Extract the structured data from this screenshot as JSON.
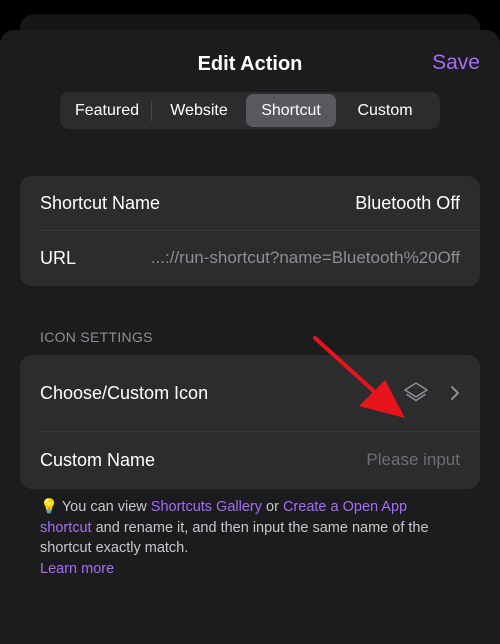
{
  "header": {
    "title": "Edit Action",
    "save_label": "Save"
  },
  "tabs": [
    {
      "label": "Featured",
      "active": false
    },
    {
      "label": "Website",
      "active": false
    },
    {
      "label": "Shortcut",
      "active": true
    },
    {
      "label": "Custom",
      "active": false
    }
  ],
  "shortcut_card": {
    "name_label": "Shortcut Name",
    "name_value": "Bluetooth Off",
    "url_label": "URL",
    "url_value": "...://run-shortcut?name=Bluetooth%20Off"
  },
  "icon_settings": {
    "section_title": "ICON SETTINGS",
    "choose_label": "Choose/Custom Icon",
    "icon": "layers-icon",
    "custom_name_label": "Custom Name",
    "custom_name_placeholder": "Please input"
  },
  "footer": {
    "bulb": "💡",
    "text1": " You can view ",
    "link1": "Shortcuts Gallery",
    "text2": " or ",
    "link2": "Create a Open App shortcut",
    "text3": " and rename it, and then input the same name of the shortcut exactly match.",
    "learn_more": "Learn more"
  },
  "colors": {
    "accent": "#a56cf7",
    "annotation_arrow": "#e8141b"
  }
}
